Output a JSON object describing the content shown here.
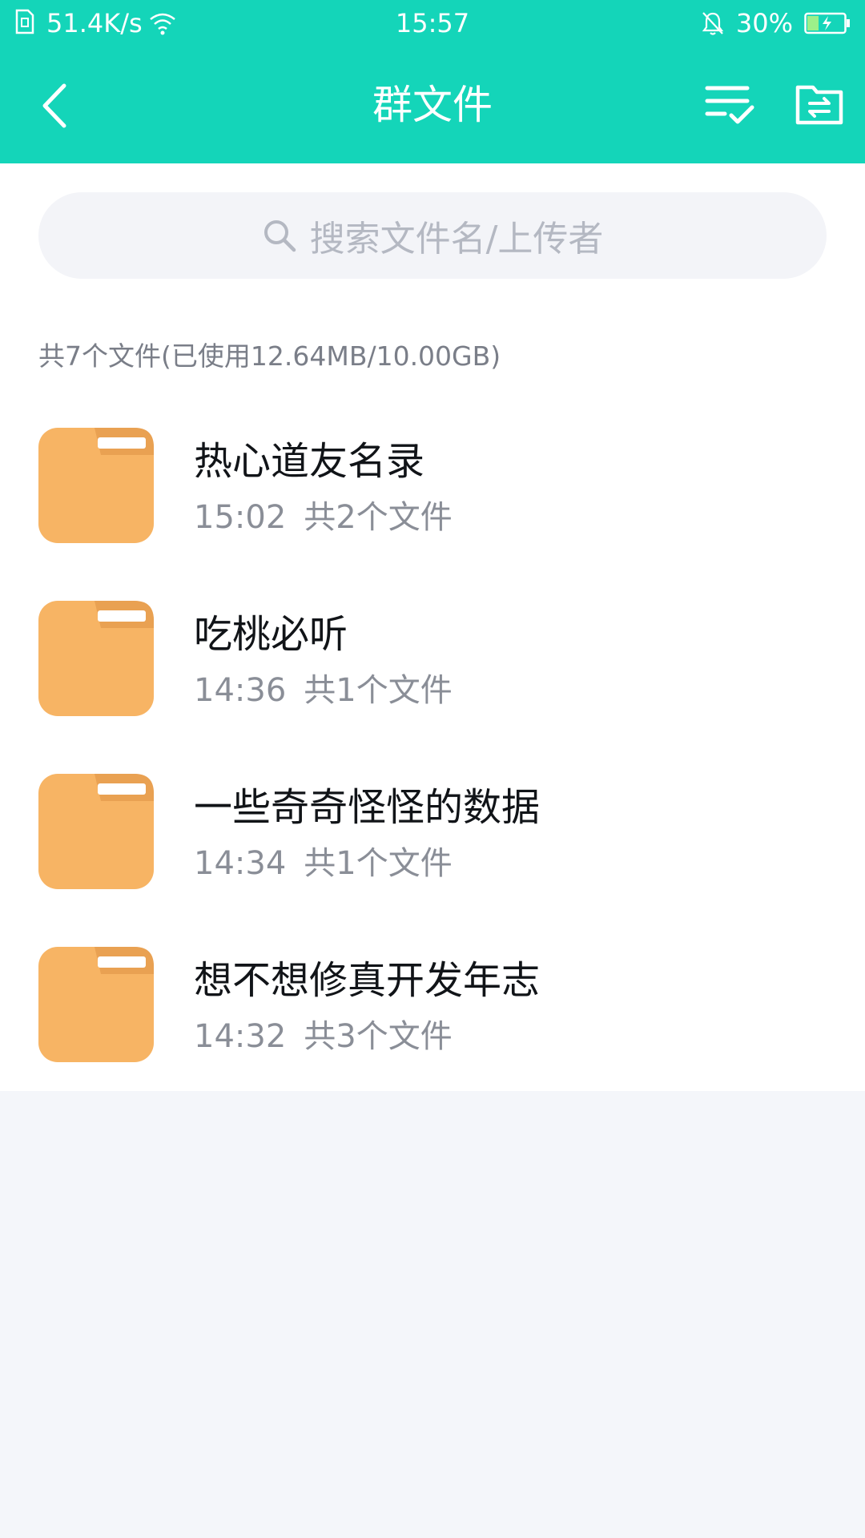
{
  "status_bar": {
    "network_speed": "51.4K/s",
    "time": "15:57",
    "battery_percent": "30%"
  },
  "title_bar": {
    "title": "群文件"
  },
  "search": {
    "placeholder": "搜索文件名/上传者"
  },
  "summary": {
    "text": "共7个文件(已使用12.64MB/10.00GB)"
  },
  "files": [
    {
      "name": "热心道友名录",
      "time": "15:02",
      "count": "共2个文件"
    },
    {
      "name": "吃桃必听",
      "time": "14:36",
      "count": "共1个文件"
    },
    {
      "name": "一些奇奇怪怪的数据",
      "time": "14:34",
      "count": "共1个文件"
    },
    {
      "name": "想不想修真开发年志",
      "time": "14:32",
      "count": "共3个文件"
    }
  ],
  "colors": {
    "header": "#14d5b9",
    "folder": "#f7b464",
    "folder_tab": "#e9a152",
    "background": "#f4f6fa"
  },
  "icons": {
    "back": "chevron-left-icon",
    "select": "checklist-icon",
    "folder_transfer": "folder-transfer-icon",
    "search": "search-icon",
    "folder": "folder-icon"
  }
}
